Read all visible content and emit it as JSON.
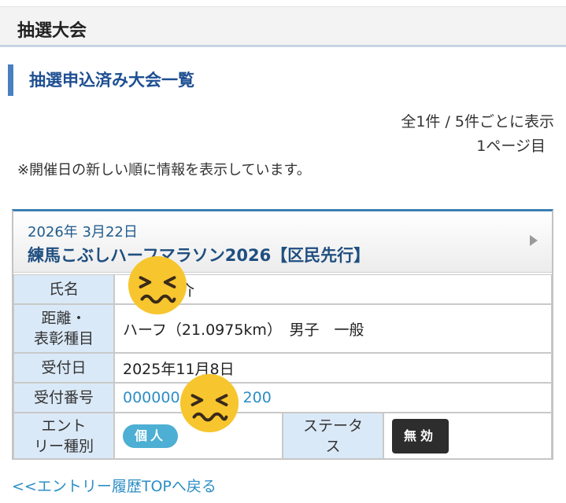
{
  "header": {
    "title": "抽選大会"
  },
  "section": {
    "title": "抽選申込済み大会一覧"
  },
  "pagination": {
    "count_text": "全1件 / 5件ごとに表示",
    "page_text": "1ページ目"
  },
  "note": "※開催日の新しい順に情報を表示しています。",
  "event": {
    "date": "2026年 3月22日",
    "title": "練馬こぶしハーフマラソン2026【区民先行】",
    "rows": {
      "name_label": "氏名",
      "name_value_visible": "",
      "name_value_tail": "介",
      "distance_label_1": "距離・",
      "distance_label_2": "表彰種目",
      "distance_value": "ハーフ（21.0975km）　男子　一般",
      "received_label": "受付日",
      "received_value": "2025年11月8日",
      "number_label": "受付番号",
      "number_value_head": "000000",
      "number_value_tail": "200",
      "entry_type_label_1": "エント",
      "entry_type_label_2": "リー種別",
      "entry_type_value": "個人",
      "status_label_1": "ステータ",
      "status_label_2": "ス",
      "status_value": "無効"
    }
  },
  "back_link": "<<エントリー履歴TOPへ戻る",
  "colors": {
    "accent": "#4a7fc1",
    "link": "#2d8ec6",
    "label_bg": "#dae9f7",
    "badge_kojin": "#4dafd3",
    "badge_mukou": "#2d2d2d"
  }
}
